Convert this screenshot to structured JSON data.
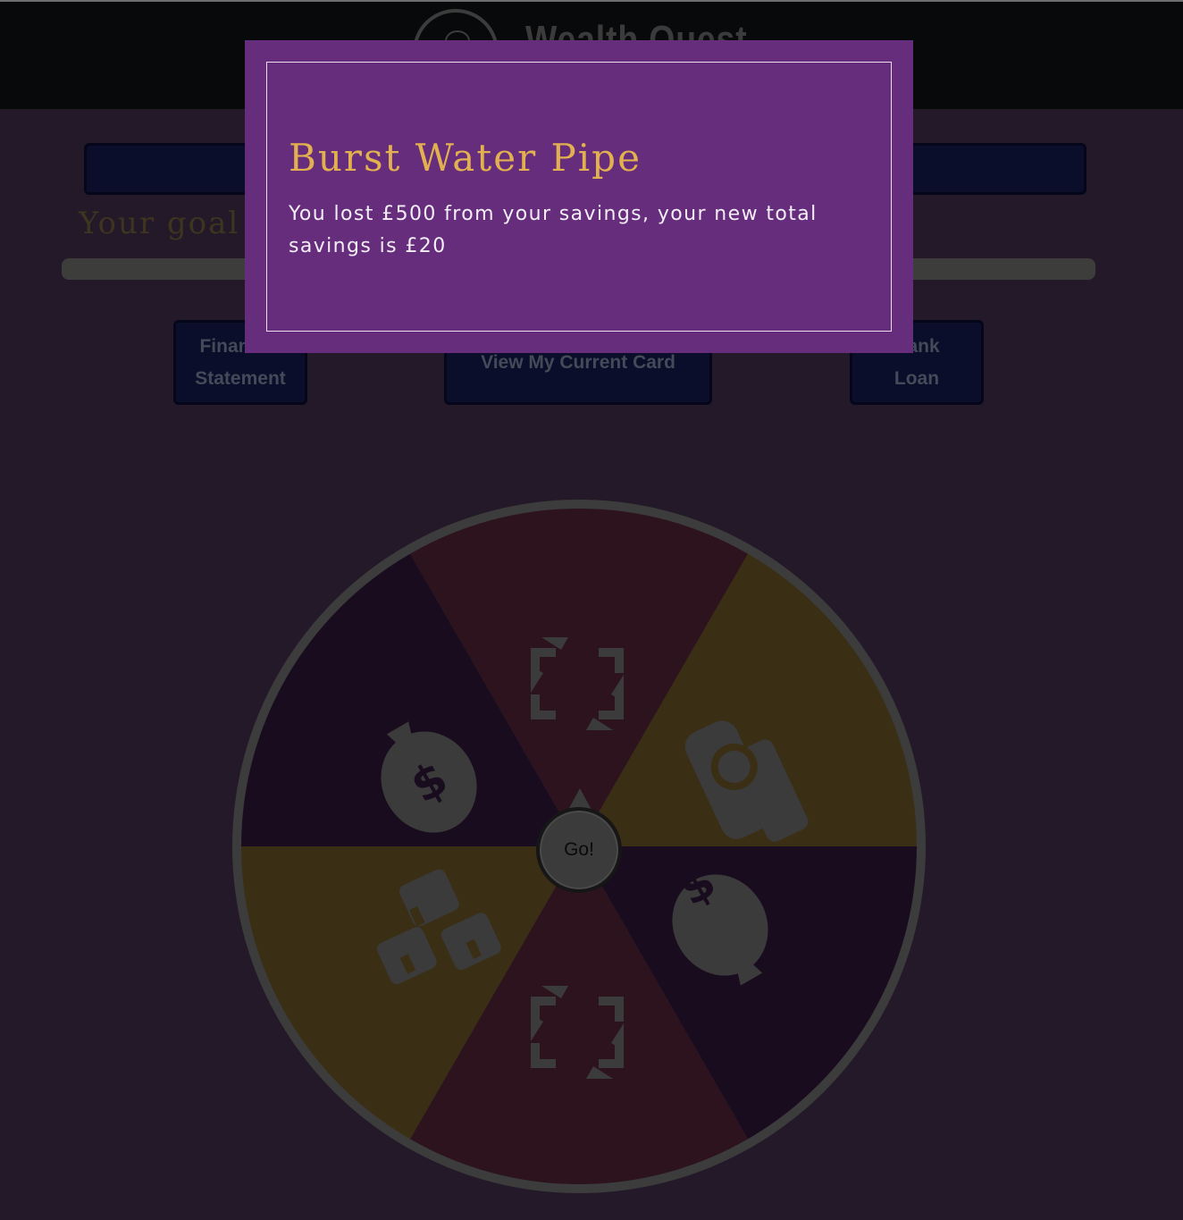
{
  "header": {
    "title": "Wealth Quest",
    "logo_icon": "brain-icon"
  },
  "goal": {
    "text": "Your goal",
    "progress": 0.0
  },
  "buttons": {
    "financial_statement": [
      "Financial",
      "Statement"
    ],
    "current_card": "View My Current Card",
    "bank_loan": [
      "Bank",
      "Loan"
    ]
  },
  "wheel": {
    "go_label": "Go!",
    "segments": [
      {
        "icon": "refresh-arrows-icon",
        "color": "#2c131e"
      },
      {
        "icon": "hand-coin-icon",
        "color": "#3a2e14"
      },
      {
        "icon": "money-bag-icon",
        "color": "#190c1f"
      },
      {
        "icon": "refresh-arrows-icon",
        "color": "#2c131e"
      },
      {
        "icon": "cash-stack-icon",
        "color": "#3a2e14"
      },
      {
        "icon": "money-bag-icon",
        "color": "#190c1f"
      }
    ]
  },
  "modal": {
    "title": "Burst Water Pipe",
    "message": "You lost £500 from your savings, your new total savings is £20"
  }
}
